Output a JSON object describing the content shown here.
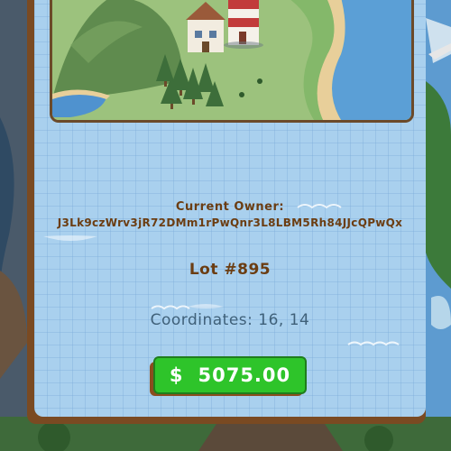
{
  "plot": {
    "owner_label": "Current Owner:",
    "owner_address": "J3Lk9czWrv3jR72DMm1rPwQnr3L8LBM5Rh84JJcQPwQx",
    "lot_title": "Lot #895",
    "coordinates_text": "Coordinates: 16, 14"
  },
  "purchase": {
    "currency_symbol": "$",
    "price": "5075.00"
  },
  "colors": {
    "card_bg": "#a9d0ee",
    "card_border": "#7a4a22",
    "text_brown": "#6b3d12",
    "coords_text": "#3f6079",
    "price_green": "#2ec42a"
  }
}
